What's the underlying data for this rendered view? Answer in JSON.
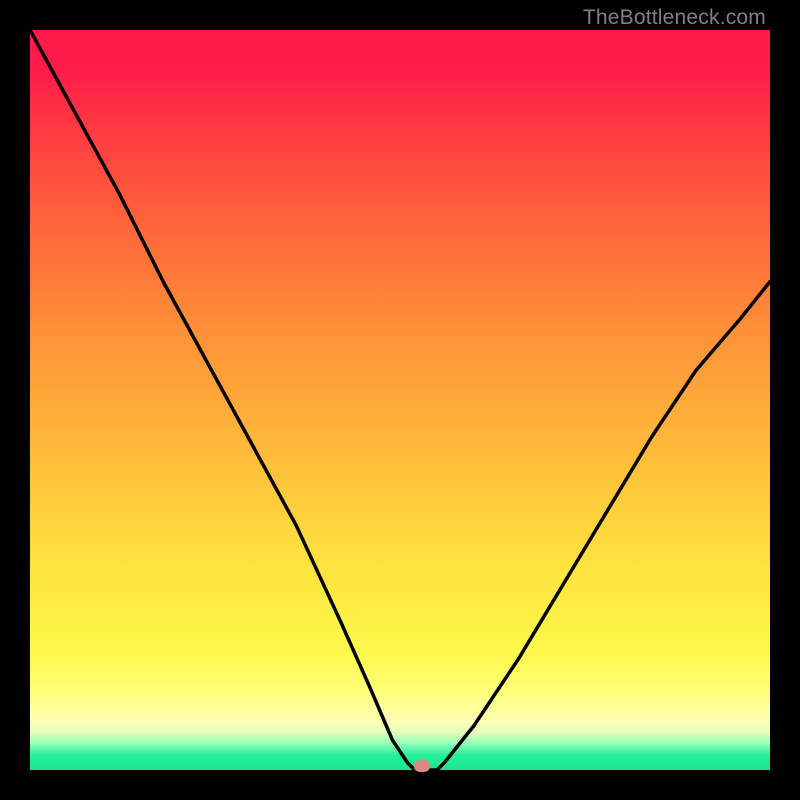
{
  "watermark": "TheBottleneck.com",
  "chart_data": {
    "type": "line",
    "title": "",
    "xlabel": "",
    "ylabel": "",
    "xlim": [
      0,
      100
    ],
    "ylim": [
      0,
      100
    ],
    "grid": false,
    "legend": false,
    "series": [
      {
        "name": "bottleneck-curve",
        "x": [
          0,
          6,
          12,
          18,
          24,
          30,
          36,
          42,
          46,
          49,
          51,
          52,
          55,
          56,
          60,
          66,
          72,
          78,
          84,
          90,
          96,
          100
        ],
        "values": [
          100,
          89,
          78,
          66,
          55,
          44,
          33,
          20,
          11,
          4,
          1,
          0,
          0,
          1,
          6,
          15,
          25,
          35,
          45,
          54,
          61,
          66
        ]
      }
    ],
    "annotations": [
      {
        "name": "optimal-marker",
        "x": 53,
        "y": 0.5
      }
    ],
    "background_gradient": {
      "top": "#ff1a4a",
      "bottom": "#19e88f",
      "meaning": "red-high-bottleneck-to-green-low-bottleneck"
    }
  }
}
